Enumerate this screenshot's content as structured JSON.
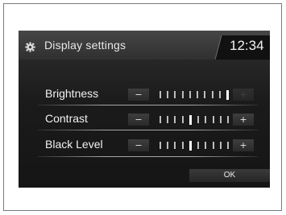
{
  "header": {
    "title": "Display settings",
    "clock": "12:34",
    "icon": "gear-icon"
  },
  "settings": [
    {
      "label": "Brightness",
      "minus": "−",
      "plus": "+",
      "level": 10,
      "steps": 10,
      "plus_enabled": false
    },
    {
      "label": "Contrast",
      "minus": "−",
      "plus": "+",
      "level": 5,
      "steps": 10,
      "plus_enabled": true
    },
    {
      "label": "Black Level",
      "minus": "−",
      "plus": "+",
      "level": 5,
      "steps": 10,
      "plus_enabled": true
    }
  ],
  "footer": {
    "ok_label": "OK"
  },
  "colors": {
    "screen_bg": "#1b1b1b",
    "text": "#f1f1f1",
    "tick": "#bdbdbd",
    "tick_active": "#ffffff"
  }
}
